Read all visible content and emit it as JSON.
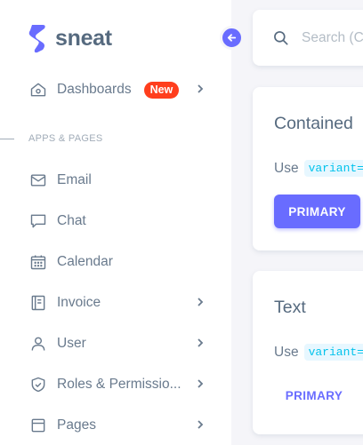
{
  "brand": {
    "name": "sneat",
    "accent": "#696cff"
  },
  "sidebar": {
    "dashboards": {
      "label": "Dashboards",
      "badge": "New",
      "icon": "home-icon"
    },
    "section_header": "APPS & PAGES",
    "items": [
      {
        "label": "Email",
        "icon": "mail-icon",
        "has_children": false
      },
      {
        "label": "Chat",
        "icon": "chat-icon",
        "has_children": false
      },
      {
        "label": "Calendar",
        "icon": "calendar-icon",
        "has_children": false
      },
      {
        "label": "Invoice",
        "icon": "invoice-icon",
        "has_children": true
      },
      {
        "label": "User",
        "icon": "user-icon",
        "has_children": true
      },
      {
        "label": "Roles & Permissio...",
        "icon": "shield-icon",
        "has_children": true
      },
      {
        "label": "Pages",
        "icon": "pages-icon",
        "has_children": true
      }
    ]
  },
  "search": {
    "placeholder": "Search (C"
  },
  "cards": {
    "contained": {
      "title": "Contained",
      "use_text": "Use",
      "code": "variant='c",
      "button_label": "PRIMARY"
    },
    "text": {
      "title": "Text",
      "use_text": "Use",
      "code": "variant='t",
      "button_label": "PRIMARY"
    }
  }
}
